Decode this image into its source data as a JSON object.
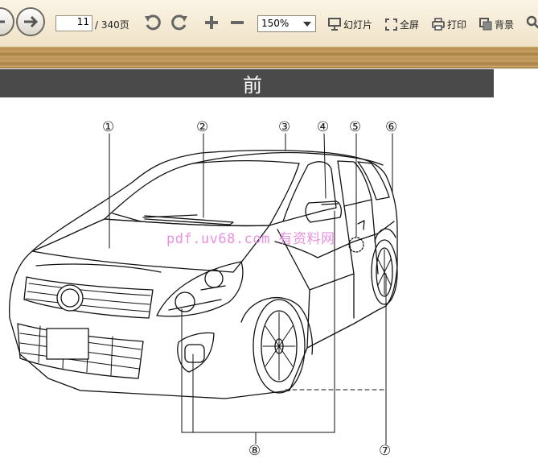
{
  "toolbar": {
    "page_current": "11",
    "page_total": "/ 340页",
    "zoom": "150%",
    "slideshow_label": "幻灯片",
    "fullscreen_label": "全屏",
    "print_label": "打印",
    "background_label": "背景",
    "icons": [
      "back-icon",
      "forward-icon",
      "rotate-left-icon",
      "rotate-right-icon",
      "zoom-in-icon",
      "zoom-out-icon",
      "slideshow-icon",
      "fullscreen-icon",
      "print-icon",
      "background-icon",
      "search-icon"
    ]
  },
  "page": {
    "header_title": "前",
    "watermark": "pdf.uv68.com 有资料网",
    "callouts": [
      "①",
      "②",
      "③",
      "④",
      "⑤",
      "⑥",
      "⑦",
      "⑧"
    ]
  }
}
